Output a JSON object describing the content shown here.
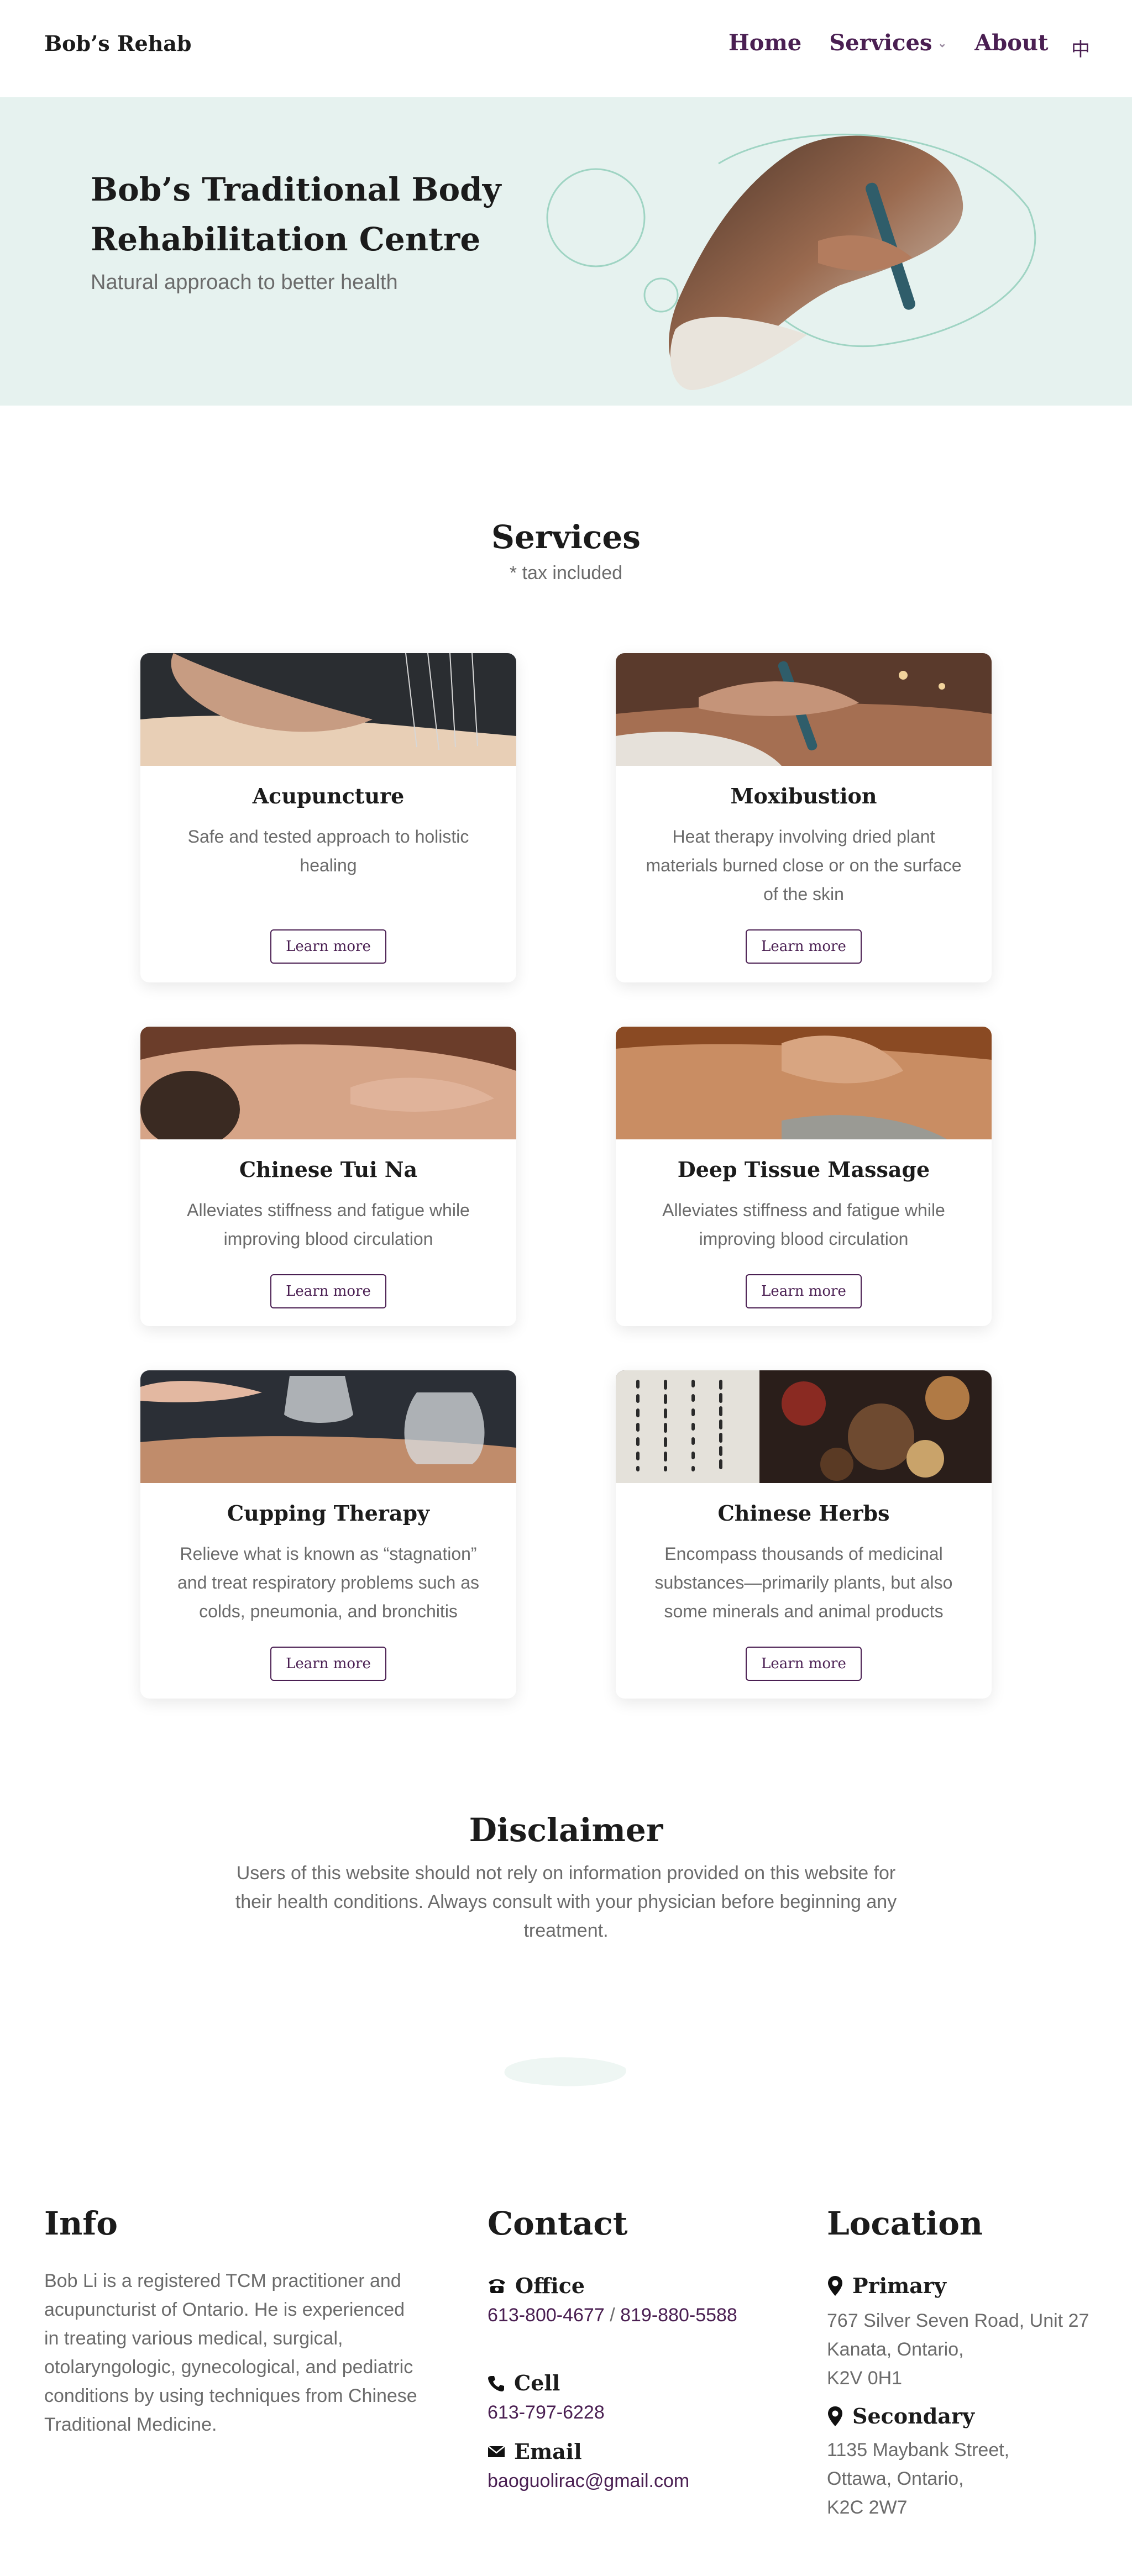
{
  "nav": {
    "brand": "Bob’s Rehab",
    "links": [
      "Home",
      "Services",
      "About"
    ],
    "services_chevron": "chevron-down-icon",
    "lang": "中"
  },
  "hero": {
    "title": "Bob’s Traditional Body Rehabilitation Centre",
    "subtitle": "Natural approach to better health"
  },
  "services": {
    "title": "Services",
    "note": "* tax included",
    "cards": [
      {
        "title": "Acupuncture",
        "desc": "Safe and tested approach to holistic healing",
        "button": "Learn more"
      },
      {
        "title": "Moxibustion",
        "desc": "Heat therapy involving dried plant materials burned close or on the surface of the skin",
        "button": "Learn more"
      },
      {
        "title": "Chinese Tui Na",
        "desc": "Alleviates stiffness and fatigue while improving blood circulation",
        "button": "Learn more"
      },
      {
        "title": "Deep Tissue Massage",
        "desc": "Alleviates stiffness and fatigue while improving blood circulation",
        "button": "Learn more"
      },
      {
        "title": "Cupping Therapy",
        "desc": "Relieve what is known as “stagnation” and treat respiratory problems such as colds, pneumonia, and bronchitis",
        "button": "Learn more"
      },
      {
        "title": "Chinese Herbs",
        "desc": "Encompass thousands of medicinal substances—primarily plants, but also some minerals and animal products",
        "button": "Learn more"
      }
    ]
  },
  "disclaimer": {
    "title": "Disclaimer",
    "text": "Users of this website should not rely on information provided on this website for their health conditions. Always consult with your physician before beginning any treatment."
  },
  "footer": {
    "info": {
      "title": "Info",
      "text": "Bob Li is a registered TCM practitioner and acupuncturist of Ontario. He is experienced in treating various medical, surgical, otolaryngologic, gynecological, and pediatric conditions by using techniques from Chinese Traditional Medicine."
    },
    "contact": {
      "title": "Contact",
      "office_label": "Office",
      "office_phone_1": "613-800-4677",
      "office_sep": " / ",
      "office_phone_2": "819-880-5588",
      "cell_label": "Cell",
      "cell_phone": "613-797-6228",
      "email_label": "Email",
      "email": "baoguolirac@gmail.com"
    },
    "location": {
      "title": "Location",
      "primary_label": "Primary",
      "primary_lines": [
        "767 Silver Seven Road, Unit 27",
        "Kanata, Ontario,",
        "K2V 0H1"
      ],
      "secondary_label": "Secondary",
      "secondary_lines": [
        "1135 Maybank Street,",
        "Ottawa, Ontario,",
        "K2C 2W7"
      ]
    }
  },
  "colors": {
    "accent": "#4a1f52",
    "hero_bg": "#e6f2ef",
    "heading": "#1b1b1b",
    "body_text": "#6b6b6b"
  }
}
